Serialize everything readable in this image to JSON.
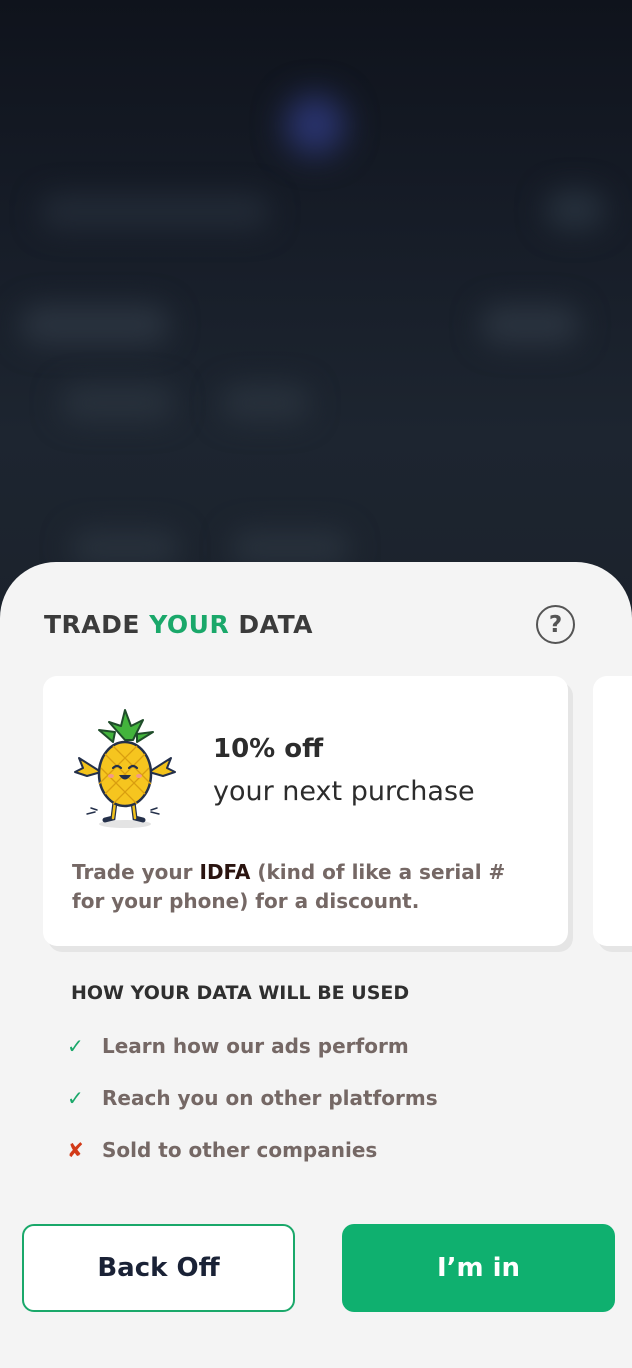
{
  "sheet": {
    "title_prefix": "TRADE ",
    "title_accent": "YOUR",
    "title_suffix": " DATA",
    "help_icon": "?",
    "offer": {
      "title": "10% off",
      "subtitle": "your next purchase",
      "desc_prefix": "Trade your ",
      "desc_strong": "IDFA",
      "desc_suffix": " (kind of like a serial # for your phone) for a discount.",
      "mascot": "pineapple-mascot"
    },
    "section_title": "HOW YOUR DATA WILL BE USED",
    "uses": [
      {
        "icon": "✓",
        "type": "check-icon",
        "label": "Learn how our ads perform"
      },
      {
        "icon": "✓",
        "type": "check-icon",
        "label": "Reach you on other platforms"
      },
      {
        "icon": "✘",
        "type": "cross-icon",
        "label": "Sold to other companies"
      }
    ],
    "buttons": {
      "back_label": "Back Off",
      "accept_label": "I’m in"
    }
  },
  "colors": {
    "accent": "#1aa86a",
    "button_primary": "#0fb06f",
    "negative": "#d23a18",
    "sheet_bg": "#f4f4f4"
  }
}
